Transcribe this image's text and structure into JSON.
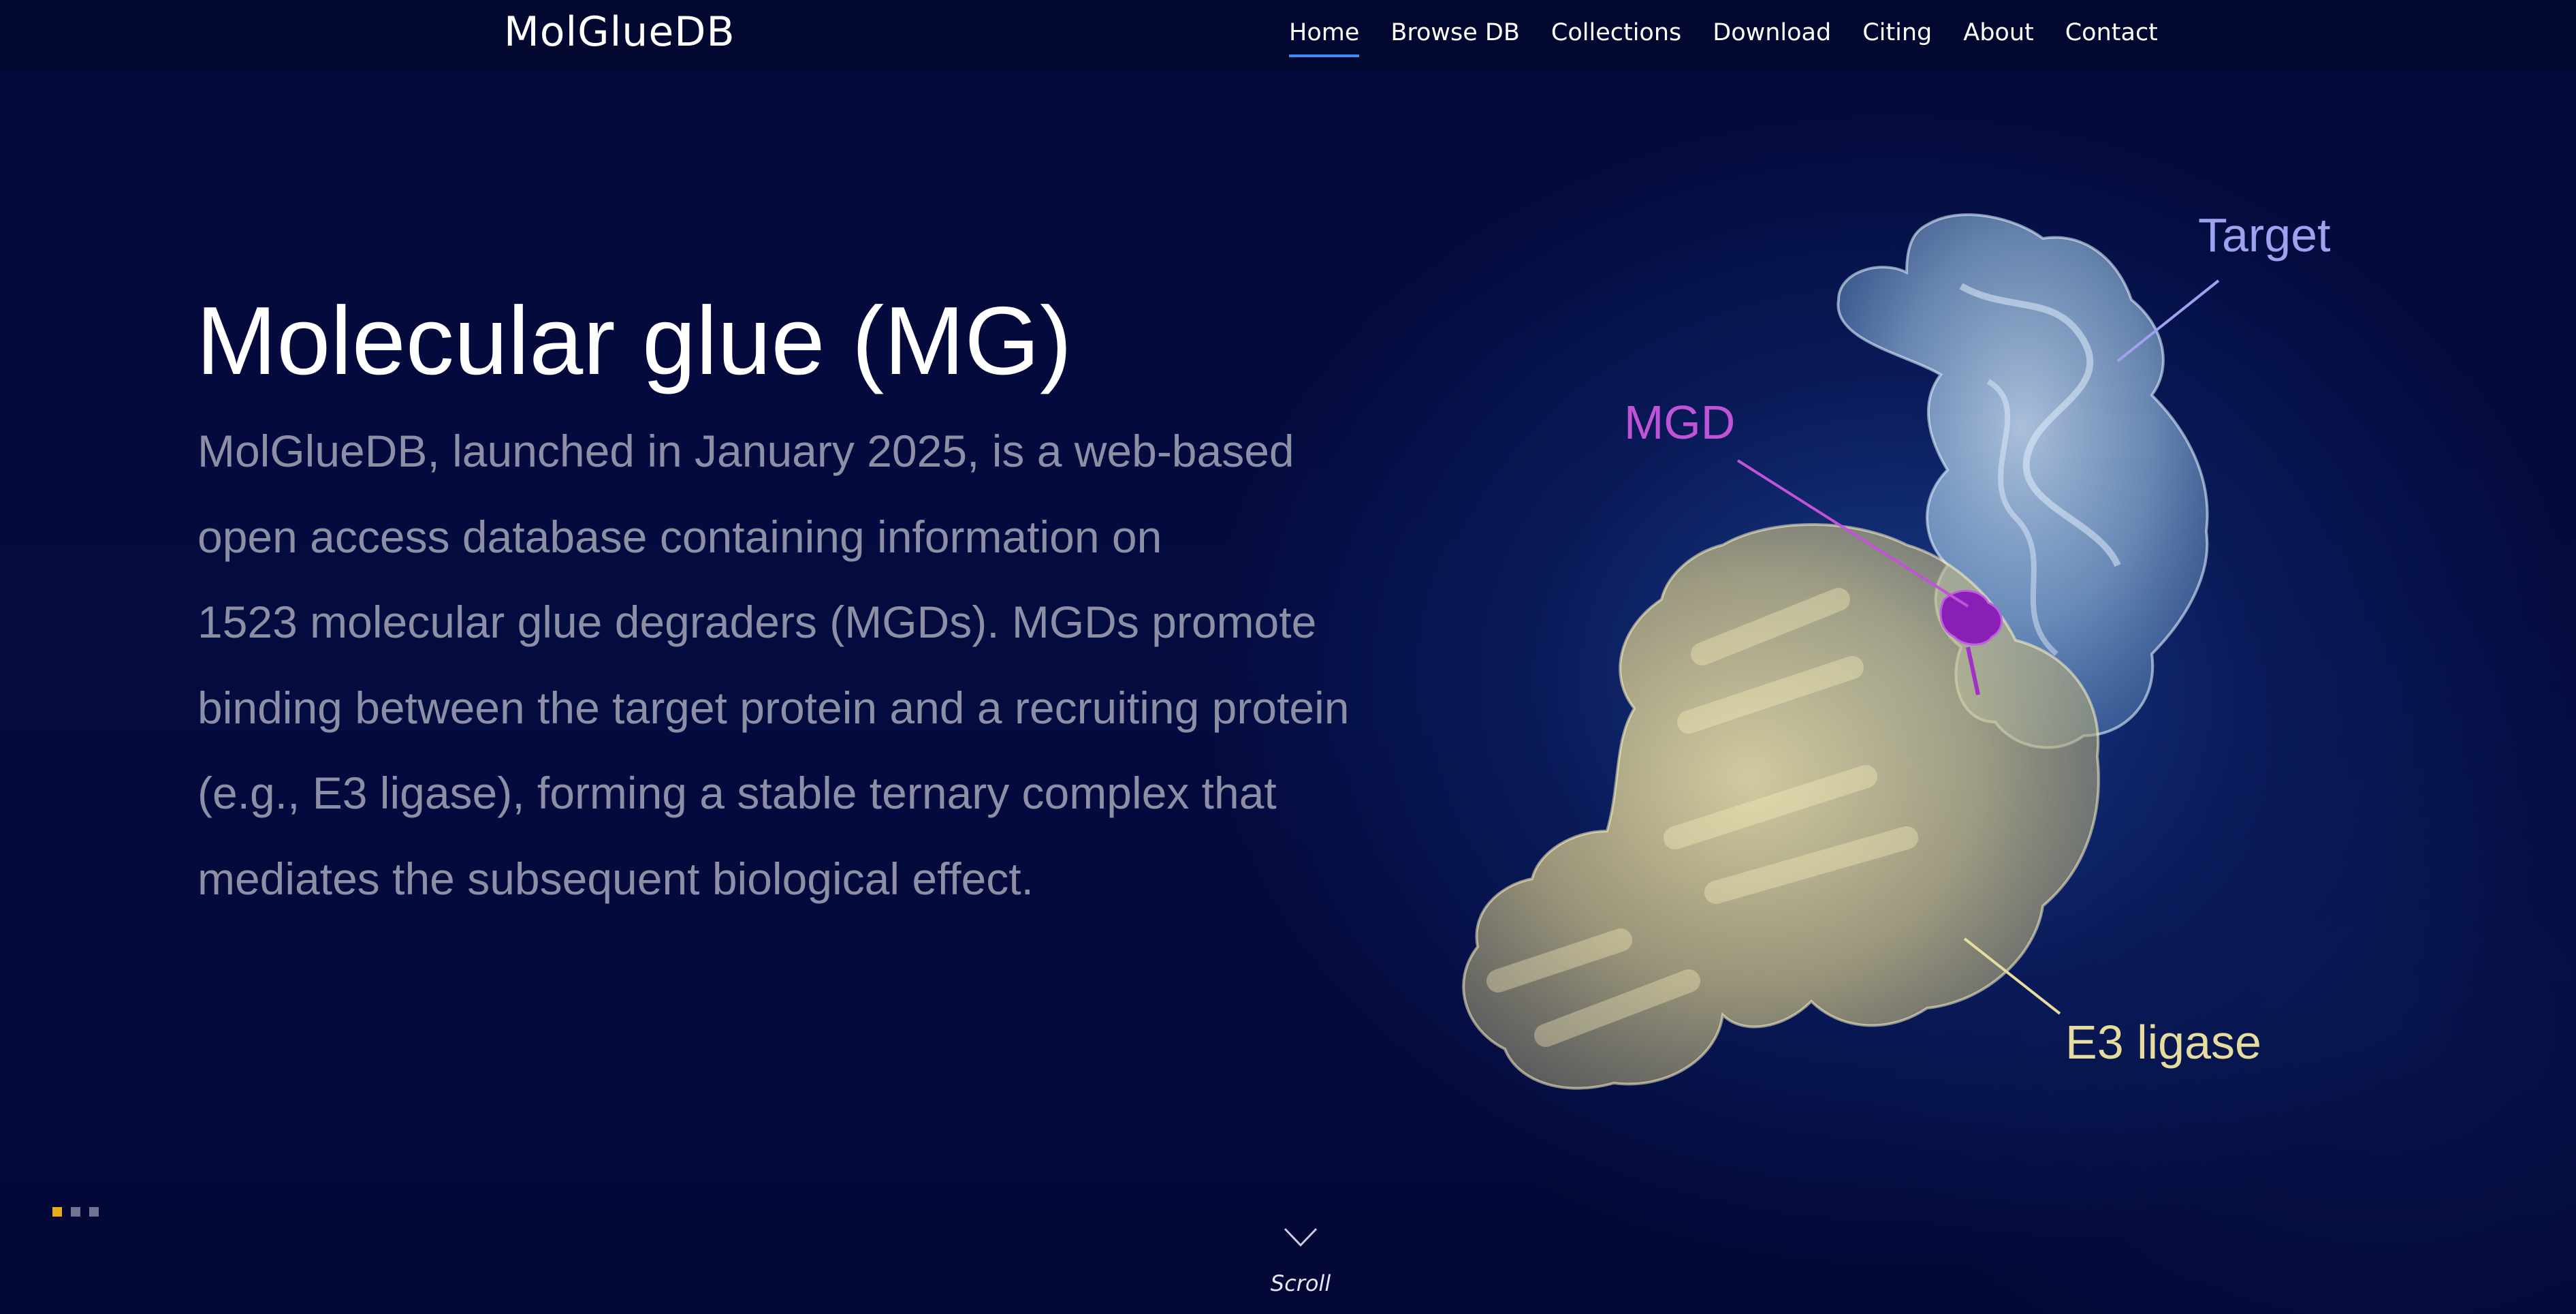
{
  "app": {
    "logo": "MolGlueDB"
  },
  "nav": {
    "items": [
      {
        "label": "Home",
        "active": true
      },
      {
        "label": "Browse DB",
        "active": false
      },
      {
        "label": "Collections",
        "active": false
      },
      {
        "label": "Download",
        "active": false
      },
      {
        "label": "Citing",
        "active": false
      },
      {
        "label": "About",
        "active": false
      },
      {
        "label": "Contact",
        "active": false
      }
    ],
    "accent_color": "#3e8df5"
  },
  "hero": {
    "title": "Molecular glue (MG)",
    "description_lines": [
      "MolGlueDB, launched in January 2025, is a web-based",
      "open access database containing information on",
      "1523 molecular glue degraders (MGDs). MGDs promote",
      "binding between the target protein and a recruiting protein",
      "(e.g., E3 ligase), forming a stable ternary complex that",
      "mediates the subsequent biological effect."
    ]
  },
  "illustration": {
    "labels": {
      "target": "Target",
      "mgd": "MGD",
      "e3": "E3 ligase"
    },
    "colors": {
      "target": "#9ea2ef",
      "mgd": "#c054d6",
      "e3": "#e6dc9e"
    }
  },
  "slides": {
    "count": 3,
    "active_index": 0,
    "active_color": "#e6ae1a"
  },
  "scroll": {
    "label": "Scroll",
    "icon": "chevron-down-icon"
  }
}
